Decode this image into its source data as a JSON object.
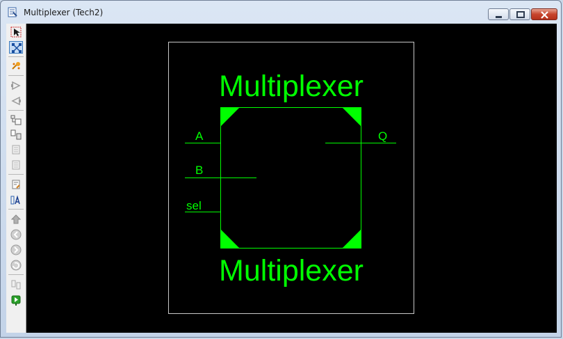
{
  "window": {
    "title": "Multiplexer (Tech2)"
  },
  "toolbar": {
    "items": [
      {
        "name": "select-arrow-icon",
        "state": "normal"
      },
      {
        "name": "wiring-node-icon",
        "state": "active"
      },
      {
        "name": "sparkle-icon",
        "state": "normal"
      },
      {
        "name": "play-right-icon",
        "state": "disabled"
      },
      {
        "name": "play-left-icon",
        "state": "disabled"
      },
      {
        "name": "hierarchy-icon",
        "state": "normal"
      },
      {
        "name": "doc-move-icon",
        "state": "normal"
      },
      {
        "name": "doc-gray-icon",
        "state": "disabled"
      },
      {
        "name": "doc-gray-2-icon",
        "state": "disabled"
      },
      {
        "name": "doc-edit-icon",
        "state": "normal"
      },
      {
        "name": "text-a-icon",
        "state": "normal"
      },
      {
        "name": "up-arrow-icon",
        "state": "disabled"
      },
      {
        "name": "back-circle-icon",
        "state": "disabled"
      },
      {
        "name": "forward-circle-icon",
        "state": "disabled"
      },
      {
        "name": "refresh-circle-icon",
        "state": "disabled"
      },
      {
        "name": "window-split-icon",
        "state": "disabled"
      },
      {
        "name": "green-run-icon",
        "state": "normal"
      }
    ]
  },
  "schematic": {
    "title_top": "Multiplexer",
    "title_bottom": "Multiplexer",
    "inputs": [
      "A",
      "B",
      "sel"
    ],
    "output": "Q"
  },
  "colors": {
    "canvas": "#000000",
    "wire": "#00ff00",
    "frame": "#c8c8c8"
  }
}
